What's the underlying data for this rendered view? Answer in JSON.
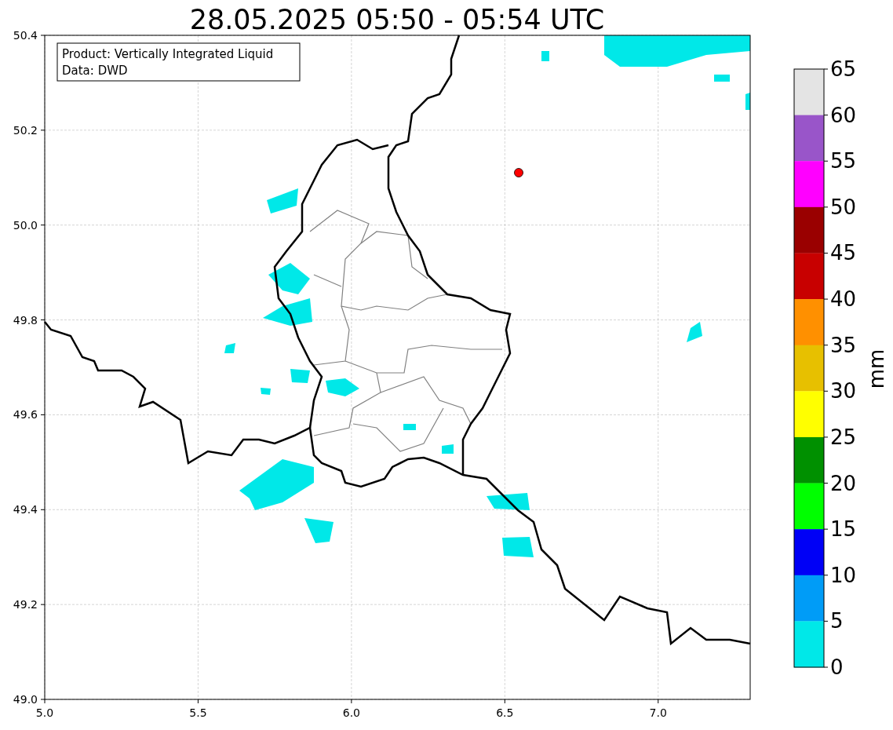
{
  "title": "28.05.2025 05:50 - 05:54 UTC",
  "info_box": {
    "lines": [
      "Product: Vertically Integrated Liquid",
      "Data: DWD"
    ]
  },
  "map": {
    "xticks": [
      "5.0",
      "5.5",
      "6.0",
      "6.5",
      "7.0"
    ],
    "yticks": [
      "50.4",
      "50.2",
      "50.0",
      "49.8",
      "49.6",
      "49.4",
      "49.2",
      "49.0"
    ]
  },
  "colorbar": {
    "label": "mm",
    "ticks": [
      "65",
      "60",
      "55",
      "50",
      "45",
      "40",
      "35",
      "30",
      "25",
      "20",
      "15",
      "10",
      "5",
      "0"
    ],
    "bands": [
      {
        "color": "#e4e4e4"
      },
      {
        "color": "#9955c9"
      },
      {
        "color": "#ff00ff"
      },
      {
        "color": "#9a0000"
      },
      {
        "color": "#c80000"
      },
      {
        "color": "#ff9000"
      },
      {
        "color": "#e7c000"
      },
      {
        "color": "#ffff00"
      },
      {
        "color": "#009000"
      },
      {
        "color": "#00ff00"
      },
      {
        "color": "#0000f6"
      },
      {
        "color": "#009cf7"
      },
      {
        "color": "#00e8e8"
      }
    ]
  }
}
